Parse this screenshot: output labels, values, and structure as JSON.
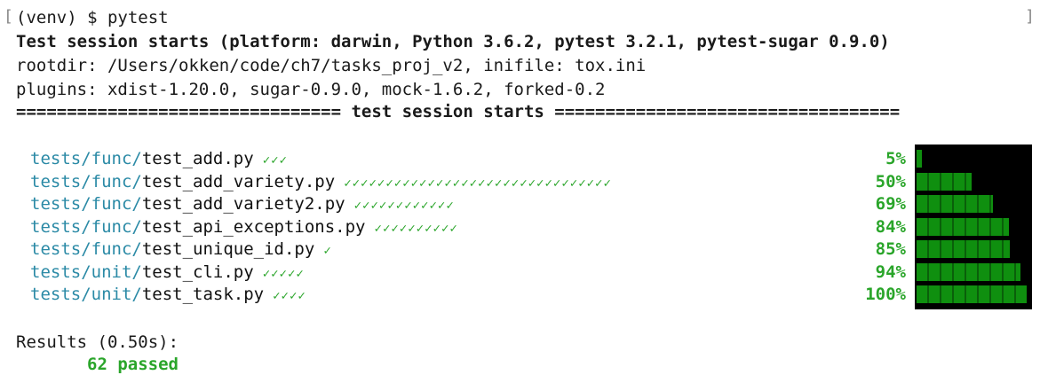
{
  "prompt_line": "(venv) $ pytest",
  "session_header": "Test session starts (platform: darwin, Python 3.6.2, pytest 3.2.1, pytest-sugar 0.9.0)",
  "rootdir_line": "rootdir: /Users/okken/code/ch7/tasks_proj_v2, inifile: tox.ini",
  "plugins_line": "plugins: xdist-1.20.0, sugar-0.9.0, mock-1.6.2, forked-0.2",
  "separator_line": "================================ test session starts ==================================",
  "tests": [
    {
      "dir": "tests/func/",
      "file": "test_add.py",
      "ticks": "✓✓✓",
      "percent": "5%",
      "progress": 0.05
    },
    {
      "dir": "tests/func/",
      "file": "test_add_variety.py",
      "ticks": "✓✓✓✓✓✓✓✓✓✓✓✓✓✓✓✓✓✓✓✓✓✓✓✓✓✓✓✓✓✓✓✓",
      "percent": "50%",
      "progress": 0.5
    },
    {
      "dir": "tests/func/",
      "file": "test_add_variety2.py",
      "ticks": "✓✓✓✓✓✓✓✓✓✓✓✓",
      "percent": "69%",
      "progress": 0.69
    },
    {
      "dir": "tests/func/",
      "file": "test_api_exceptions.py",
      "ticks": "✓✓✓✓✓✓✓✓✓✓",
      "percent": "84%",
      "progress": 0.84
    },
    {
      "dir": "tests/func/",
      "file": "test_unique_id.py",
      "ticks": "✓",
      "percent": "85%",
      "progress": 0.85
    },
    {
      "dir": "tests/unit/",
      "file": "test_cli.py",
      "ticks": "✓✓✓✓✓",
      "percent": "94%",
      "progress": 0.94
    },
    {
      "dir": "tests/unit/",
      "file": "test_task.py",
      "ticks": "✓✓✓✓",
      "percent": "100%",
      "progress": 1.0
    }
  ],
  "results_line": "Results (0.50s):",
  "passed_line": "62 passed",
  "colors": {
    "path": "#2b8aa6",
    "pass": "#2aa52a",
    "bar": "#0f8f0f",
    "bar_bg": "#000000"
  }
}
